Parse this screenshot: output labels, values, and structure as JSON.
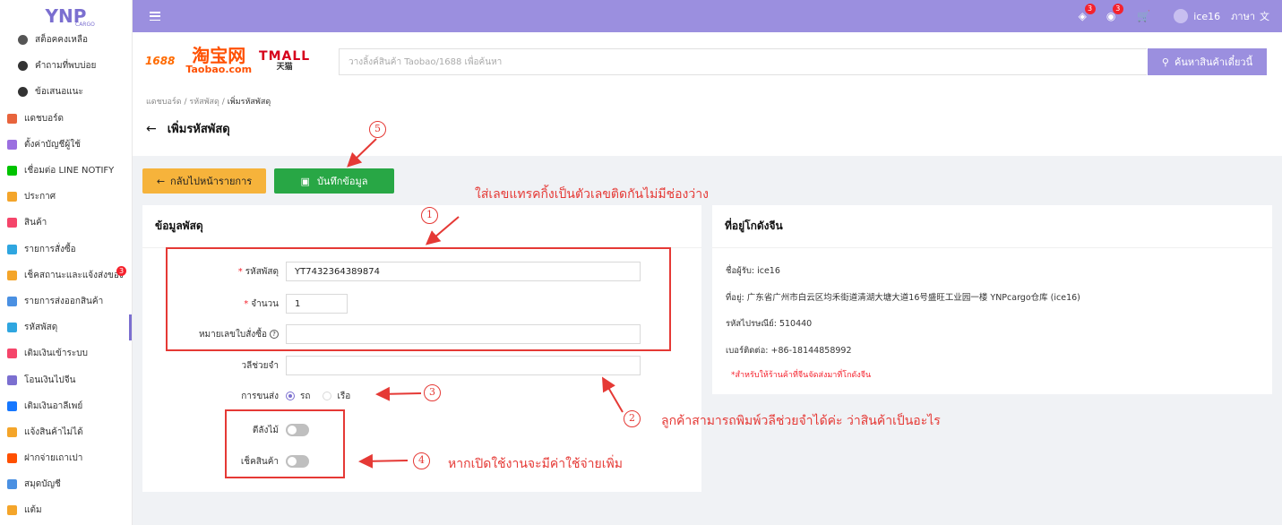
{
  "app": {
    "logo": "YNP",
    "logo_sub": "CARGO"
  },
  "sidebar": {
    "items": [
      {
        "label": "สต็อคคงเหลือ",
        "icon": "stock-icon",
        "color": "#555555",
        "sub": true
      },
      {
        "label": "คำถามที่พบบ่อย",
        "icon": "question-icon",
        "color": "#333333",
        "sub": true
      },
      {
        "label": "ข้อเสนอแนะ",
        "icon": "chat-icon",
        "color": "#333333",
        "sub": true
      },
      {
        "label": "แดชบอร์ด",
        "icon": "dashboard-icon",
        "color": "#e8643c"
      },
      {
        "label": "ตั้งค่าบัญชีผู้ใช้",
        "icon": "user-settings-icon",
        "color": "#9b6fe0"
      },
      {
        "label": "เชื่อมต่อ LINE NOTIFY",
        "icon": "line-icon",
        "color": "#00c300"
      },
      {
        "label": "ประกาศ",
        "icon": "announce-icon",
        "color": "#f4a52a"
      },
      {
        "label": "สินค้า",
        "icon": "product-icon",
        "color": "#f5456a"
      },
      {
        "label": "รายการสั่งซื้อ",
        "icon": "order-icon",
        "color": "#2fa6e0"
      },
      {
        "label": "เช็คสถานะและแจ้งส่งของ",
        "icon": "check-status-icon",
        "color": "#f4a52a",
        "badge": "3"
      },
      {
        "label": "รายการส่งออกสินค้า",
        "icon": "export-icon",
        "color": "#4a90e2"
      },
      {
        "label": "รหัสพัสดุ",
        "icon": "parcel-icon",
        "color": "#2fa6e0",
        "active": true
      },
      {
        "label": "เติมเงินเข้าระบบ",
        "icon": "topup-icon",
        "color": "#f5456a"
      },
      {
        "label": "โอนเงินไปจีน",
        "icon": "transfer-china-icon",
        "color": "#7b6fd0"
      },
      {
        "label": "เติมเงินอาลีเพย์",
        "icon": "alipay-icon",
        "color": "#1677ff"
      },
      {
        "label": "แจ้งสินค้าไม่ได้",
        "icon": "report-icon",
        "color": "#f4a52a"
      },
      {
        "label": "ฝากจ่ายเถาเปา",
        "icon": "taobao-pay-icon",
        "color": "#ff5000"
      },
      {
        "label": "สมุดบัญชี",
        "icon": "book-icon",
        "color": "#4a90e2"
      },
      {
        "label": "แต้ม",
        "icon": "points-icon",
        "color": "#f4a52a"
      }
    ]
  },
  "topbar": {
    "badge_1": "3",
    "badge_2": "3",
    "username": "ice16",
    "language": "ภาษา"
  },
  "search": {
    "brand_1688": "1688",
    "taobao_cn": "淘宝网",
    "taobao_en": "Taobao.com",
    "tmall_en": "TMALL",
    "tmall_cn": "天猫",
    "placeholder": "วางลิ้งค์สินค้า Taobao/1688 เพื่อค้นหา",
    "button": "ค้นหาสินค้าเดี๋ยวนี้"
  },
  "breadcrumb": {
    "item1": "แดชบอร์ด",
    "item2": "รหัสพัสดุ",
    "current": "เพิ่มรหัสพัสดุ",
    "sep": "/"
  },
  "page": {
    "title": "เพิ่มรหัสพัสดุ"
  },
  "actions": {
    "back": "กลับไปหน้ารายการ",
    "save": "บันทึกข้อมูล"
  },
  "form": {
    "title": "ข้อมูลพัสดุ",
    "tracking_label": "รหัสพัสดุ",
    "tracking_value": "YT7432364389874",
    "qty_label": "จำนวน",
    "qty_value": "1",
    "invoice_label": "หมายเลขใบสั่งซื้อ",
    "invoice_value": "",
    "note_label": "วลีช่วยจำ",
    "note_value": "",
    "shipping_label": "การขนส่ง",
    "shipping_options": [
      "รถ",
      "เรือ"
    ],
    "shipping_selected": "รถ",
    "crate_label": "ตีลังไม้",
    "crate_on": false,
    "inspect_label": "เช็คสินค้า",
    "inspect_on": false
  },
  "warehouse": {
    "title": "ที่อยู่โกดังจีน",
    "recipient_label": "ชื่อผู้รับ:",
    "recipient": "ice16",
    "address_label": "ที่อยู่:",
    "address": "广东省广州市白云区均禾街道清湖大塘大道16号盛旺工业园一楼 YNPcargo仓库 (ice16)",
    "postcode_label": "รหัสไปรษณีย์:",
    "postcode": "510440",
    "phone_label": "เบอร์ติดต่อ:",
    "phone": "+86-18144858992",
    "note": "*สำหรับให้ร้านค้าที่จีนจัดส่งมาที่โกดังจีน"
  },
  "annotations": {
    "n1": "1",
    "n2": "2",
    "n3": "3",
    "n4": "4",
    "n5": "5",
    "text1": "ใส่เลขแทรคกิ้งเป็นตัวเลขติดกันไม่มีช่องว่าง",
    "text2": "ลูกค้าสามารถพิมพ์วลีช่วยจำได้ค่ะ ว่าสินค้าเป็นอะไร",
    "text4": "หากเปิดใช้งานจะมีค่าใช้จ่ายเพิ่ม"
  },
  "colors": {
    "accent": "#9b8fdf",
    "save": "#28a745",
    "back": "#f6b33b",
    "annotation": "#e53935"
  }
}
